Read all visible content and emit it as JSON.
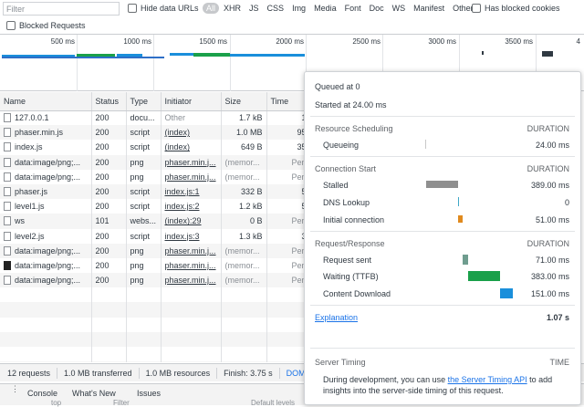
{
  "filter": {
    "placeholder": "Filter",
    "hide_data_urls": "Hide data URLs",
    "type_buttons": [
      "All",
      "XHR",
      "JS",
      "CSS",
      "Img",
      "Media",
      "Font",
      "Doc",
      "WS",
      "Manifest",
      "Other"
    ],
    "has_blocked_cookies": "Has blocked cookies",
    "blocked_requests": "Blocked Requests"
  },
  "overview": {
    "ticks": [
      "500 ms",
      "1000 ms",
      "1500 ms",
      "2000 ms",
      "2500 ms",
      "3000 ms",
      "3500 ms",
      "4"
    ]
  },
  "table": {
    "columns": [
      "Name",
      "Status",
      "Type",
      "Initiator",
      "Size",
      "Time"
    ],
    "rows": [
      {
        "name": "127.0.0.1",
        "status": "200",
        "type": "docu...",
        "initiator": "Other",
        "size": "1.7 kB",
        "time": "1"
      },
      {
        "name": "phaser.min.js",
        "status": "200",
        "type": "script",
        "initiator": "(index)",
        "size": "1.0 MB",
        "time": "95"
      },
      {
        "name": "index.js",
        "status": "200",
        "type": "script",
        "initiator": "(index)",
        "size": "649 B",
        "time": "35"
      },
      {
        "name": "data:image/png;...",
        "status": "200",
        "type": "png",
        "initiator": "phaser.min.j...",
        "size": "(memor...",
        "time": "Pen"
      },
      {
        "name": "data:image/png;...",
        "status": "200",
        "type": "png",
        "initiator": "phaser.min.j...",
        "size": "(memor...",
        "time": "Pen"
      },
      {
        "name": "phaser.js",
        "status": "200",
        "type": "script",
        "initiator": "index.js:1",
        "size": "332 B",
        "time": "5"
      },
      {
        "name": "level1.js",
        "status": "200",
        "type": "script",
        "initiator": "index.js:2",
        "size": "1.2 kB",
        "time": "5"
      },
      {
        "name": "ws",
        "status": "101",
        "type": "webs...",
        "initiator": "(index):29",
        "size": "0 B",
        "time": "Pen"
      },
      {
        "name": "level2.js",
        "status": "200",
        "type": "script",
        "initiator": "index.js:3",
        "size": "1.3 kB",
        "time": "3"
      },
      {
        "name": "data:image/png;...",
        "status": "200",
        "type": "png",
        "initiator": "phaser.min.j...",
        "size": "(memor...",
        "time": "Pen"
      },
      {
        "name": "data:image/png;...",
        "status": "200",
        "type": "png",
        "initiator": "phaser.min.j...",
        "size": "(memor...",
        "time": "Pen"
      },
      {
        "name": "data:image/png;...",
        "status": "200",
        "type": "png",
        "initiator": "phaser.min.j...",
        "size": "(memor...",
        "time": "Pen"
      }
    ]
  },
  "statusbar": {
    "requests": "12 requests",
    "transferred": "1.0 MB transferred",
    "resources": "1.0 MB resources",
    "finish": "Finish: 3.75 s",
    "dom": "DOM"
  },
  "drawer": {
    "tabs": [
      "Console",
      "What's New",
      "Issues"
    ],
    "peek_top": "top",
    "peek_filter": "Filter",
    "peek_levels": "Default levels"
  },
  "timing": {
    "queued_at": "Queued at 0",
    "started_at": "Started at 24.00 ms",
    "duration_label": "DURATION",
    "sections": {
      "resource_scheduling": "Resource Scheduling",
      "connection_start": "Connection Start",
      "request_response": "Request/Response"
    },
    "rows": {
      "queueing": {
        "label": "Queueing",
        "value": "24.00 ms"
      },
      "stalled": {
        "label": "Stalled",
        "value": "389.00 ms"
      },
      "dns": {
        "label": "DNS Lookup",
        "value": "0"
      },
      "initial": {
        "label": "Initial connection",
        "value": "51.00 ms"
      },
      "sent": {
        "label": "Request sent",
        "value": "71.00 ms"
      },
      "waiting": {
        "label": "Waiting (TTFB)",
        "value": "383.00 ms"
      },
      "download": {
        "label": "Content Download",
        "value": "151.00 ms"
      }
    },
    "explanation": "Explanation",
    "total": "1.07 s",
    "server_timing": "Server Timing",
    "time_label": "TIME",
    "note_before": "During development, you can use ",
    "note_link": "the Server Timing API",
    "note_after": " to add insights into the server-side timing of this request.",
    "colors": {
      "queueing": "#c8c8c8",
      "stalled": "#8f8f8f",
      "dns": "#3fa7c7",
      "initial": "#e08a1e",
      "sent": "#6f9d8f",
      "waiting": "#1aa04a",
      "download": "#1a8fdb"
    }
  }
}
